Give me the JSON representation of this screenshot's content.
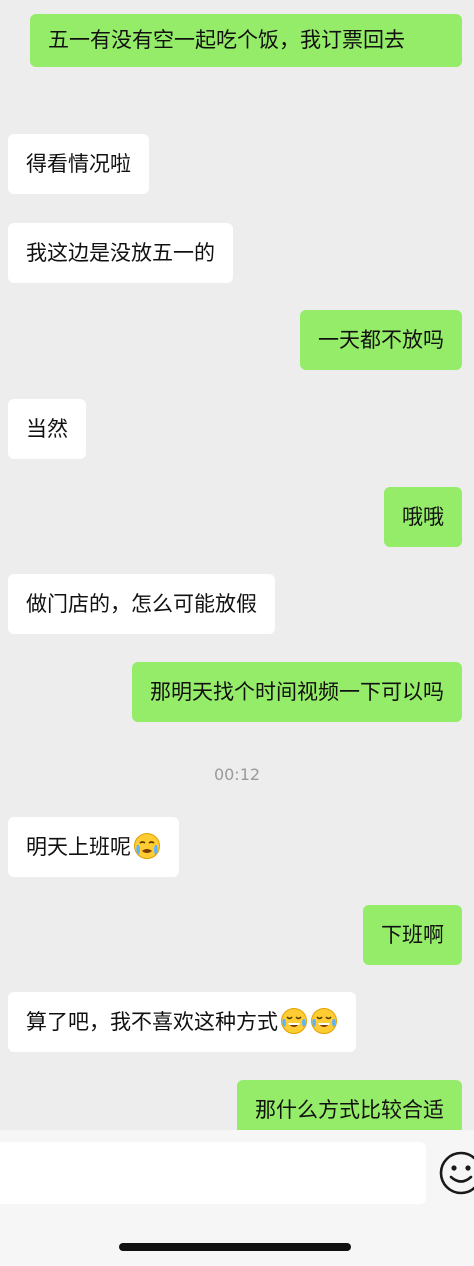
{
  "messages": [
    {
      "side": "right",
      "text": "五一有没有空一起吃个饭，我订票回去"
    },
    {
      "side": "left",
      "text": "得看情况啦"
    },
    {
      "side": "left",
      "text": "我这边是没放五一的"
    },
    {
      "side": "right",
      "text": "一天都不放吗"
    },
    {
      "side": "left",
      "text": "当然"
    },
    {
      "side": "right",
      "text": "哦哦"
    },
    {
      "side": "left",
      "text": "做门店的，怎么可能放假"
    },
    {
      "side": "right",
      "text": "那明天找个时间视频一下可以吗"
    },
    {
      "side": "left",
      "text": "明天上班呢",
      "emoji": "crying-face-emoji"
    },
    {
      "side": "right",
      "text": "下班啊"
    },
    {
      "side": "left",
      "text": "算了吧，我不喜欢这种方式",
      "emoji": "tears-of-joy-emoji x2"
    },
    {
      "side": "right",
      "text": "那什么方式比较合适"
    }
  ],
  "timestamp": "00:12",
  "colors": {
    "background": "#ededed",
    "outgoing_bubble": "#95ec69",
    "incoming_bubble": "#ffffff"
  },
  "input_bar": {
    "emoji_icon": "smiley-face-icon"
  }
}
